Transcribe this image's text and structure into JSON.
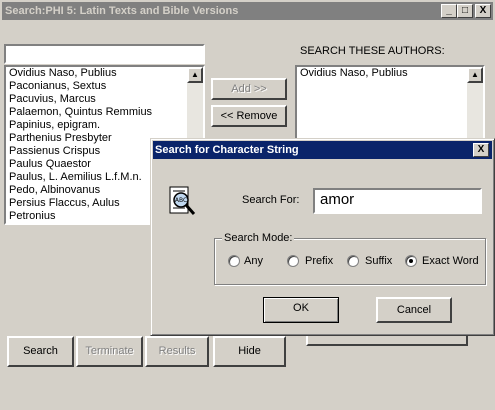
{
  "main_window": {
    "title": "Search:PHI 5: Latin Texts and Bible Versions",
    "title_buttons": [
      "_",
      "□",
      "X"
    ],
    "filter_value": "",
    "authors": [
      "Ovidius Naso, Publius",
      "Paconianus, Sextus",
      "Pacuvius, Marcus",
      "Palaemon, Quintus Remmius",
      "Papinius, epigram.",
      "Parthenius Presbyter",
      "Passienus Crispus",
      "Paulus Quaestor",
      "Paulus, L. Aemilius L.f.M.n.",
      "Pedo, Albinovanus",
      "Persius Flaccus, Aulus",
      "Petronius"
    ],
    "add_label": "Add >>",
    "remove_label": "<< Remove",
    "search_these_label": "SEARCH THESE AUTHORS:",
    "selected_authors": [
      "Ovidius Naso, Publius"
    ],
    "bottom_buttons": {
      "search": "Search",
      "terminate": "Terminate",
      "results": "Results",
      "hide": "Hide"
    }
  },
  "dialog": {
    "title": "Search for Character String",
    "close": "X",
    "search_for_label": "Search For:",
    "search_value": "amor",
    "mode_label": "Search Mode:",
    "modes": [
      "Any",
      "Prefix",
      "Suffix",
      "Exact Word"
    ],
    "selected_mode": "Exact Word",
    "ok_label": "OK",
    "cancel_label": "Cancel"
  },
  "colors": {
    "face": "#d4d0c8",
    "inactive_title": "#808080",
    "active_title": "#0a246a"
  }
}
